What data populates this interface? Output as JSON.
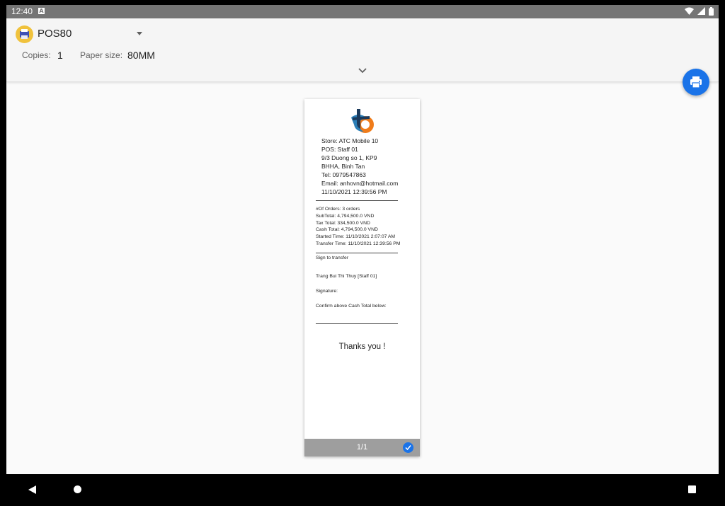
{
  "status_bar": {
    "time": "12:40",
    "notification_icon": "A"
  },
  "header": {
    "printer_name": "POS80",
    "copies_label": "Copies:",
    "copies_value": "1",
    "paper_size_label": "Paper size:",
    "paper_size_value": "80MM"
  },
  "receipt": {
    "store_lines": [
      "Store: ATC Mobile 10",
      "POS: Staff 01",
      "9/3 Duong so 1, KP9",
      "BHHA, Binh Tan",
      "Tel: 0979547863",
      "Email: anhovn@hotmail.com",
      "11/10/2021 12:39:56 PM"
    ],
    "summary_lines": [
      "#Of Orders: 3 orders",
      "SubTotal: 4,794,500.0 VND",
      "Tax Total: 334,500.0 VND",
      "Cash Total: 4,794,500.0 VND",
      "Started Time: 11/10/2021 2:07:07 AM",
      "Transfer Time: 11/10/2021 12:39:56 PM"
    ],
    "sign_to_transfer": "Sign to transfer",
    "staff_name": "Trang Bui Thi Thuy [Staff 01]",
    "signature_label": "Signature:",
    "confirm_label": "Confirm above Cash Total below:",
    "thanks": "Thanks you !"
  },
  "preview": {
    "page_indicator": "1/1"
  },
  "colors": {
    "accent": "#1a73e8",
    "status_bar": "#757575",
    "page_bar": "#9e9e9e"
  },
  "icons": {
    "fab": "print-icon",
    "page_selected": "check-icon",
    "nav": [
      "back-icon",
      "home-icon",
      "recents-icon"
    ]
  }
}
